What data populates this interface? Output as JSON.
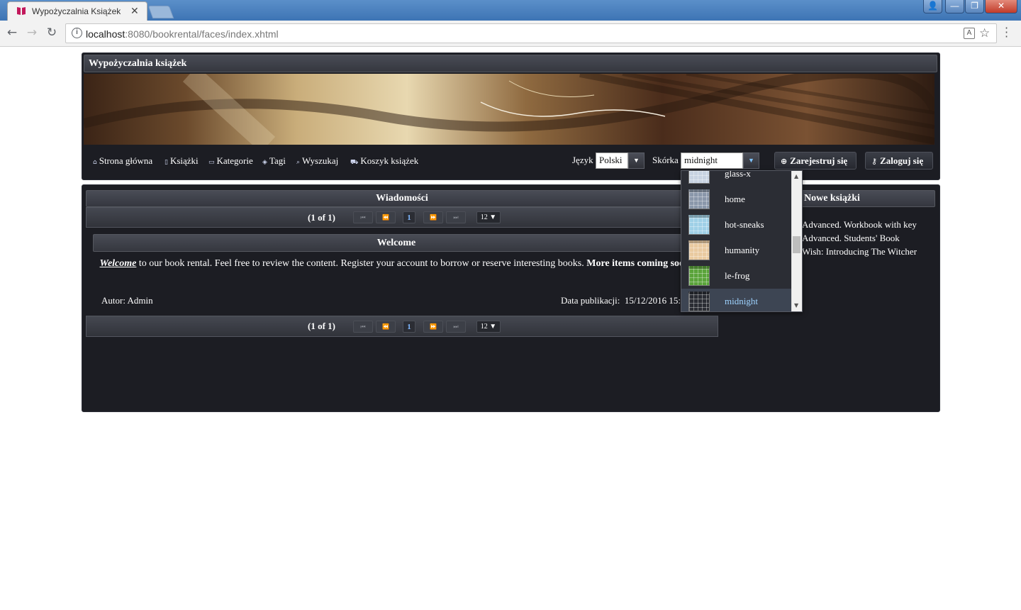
{
  "browser": {
    "tab_title": "Wypożyczalnia Książek",
    "tab_close": "✕",
    "url_host": "localhost",
    "url_path": ":8080/bookrental/faces/index.xhtml",
    "window_buttons": {
      "user": "👤",
      "minimize": "—",
      "restore": "❐",
      "close": "✕"
    },
    "icons": {
      "back": "back-arrow-icon",
      "forward": "forward-arrow-icon",
      "reload": "reload-icon",
      "info": "info-icon",
      "translate": "translate-icon",
      "star": "bookmark-star-icon",
      "menu": "menu-dots-icon"
    }
  },
  "site": {
    "title": "Wypożyczalnia książek",
    "menu": [
      {
        "label": "Strona główna",
        "icon": "home-icon"
      },
      {
        "label": "Książki",
        "icon": "document-icon"
      },
      {
        "label": "Kategorie",
        "icon": "tag-outline-icon"
      },
      {
        "label": "Tagi",
        "icon": "tag-icon"
      },
      {
        "label": "Wyszukaj",
        "icon": "search-icon"
      },
      {
        "label": "Koszyk książek",
        "icon": "cart-icon"
      }
    ],
    "language_label": "Język",
    "language_value": "Polski",
    "skin_label": "Skórka",
    "skin_value": "midnight",
    "register_button": "Zarejestruj się",
    "login_button": "Zaloguj się"
  },
  "skin_options": [
    {
      "label": "glass-x",
      "swatch": "#c8d3e2"
    },
    {
      "label": "home",
      "swatch": "#8a97aa"
    },
    {
      "label": "hot-sneaks",
      "swatch": "#9fd0e6"
    },
    {
      "label": "humanity",
      "swatch": "#e9caa0"
    },
    {
      "label": "le-frog",
      "swatch": "#5aa33a"
    },
    {
      "label": "midnight",
      "swatch": "#2a2c33",
      "selected": true
    }
  ],
  "news": {
    "header": "Wiadomości",
    "pager": {
      "report": "(1 of 1)",
      "first": "⏮",
      "prev": "⏪",
      "current_page": "1",
      "next": "⏩",
      "last": "⏭",
      "rows_per_page": "12 ▼"
    },
    "item": {
      "title": "Welcome",
      "body_emph": "Welcome",
      "body_text": " to our book rental. Feel free to review the content. Register your account to borrow or reserve interesting books. ",
      "body_bold": "More items coming soon!",
      "author": "Autor: Admin",
      "date_label": "Data publikacji:",
      "date_value": "15/12/2016 15:"
    }
  },
  "new_books": {
    "header": "Nowe książki",
    "items": [
      "Advanced. Workbook with key",
      "Advanced. Students' Book",
      "Wish: Introducing The Witcher"
    ]
  }
}
